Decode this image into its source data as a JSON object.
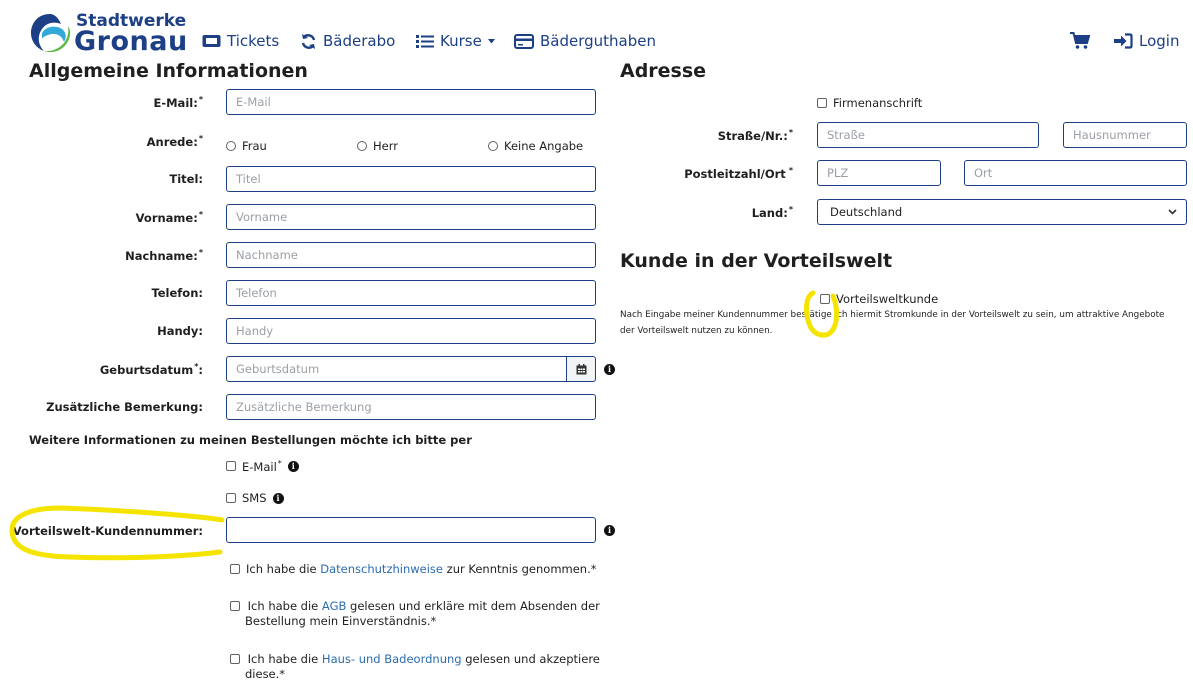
{
  "brand": {
    "line1": "Stadtwerke",
    "line2": "Gronau"
  },
  "nav": {
    "tickets": "Tickets",
    "baederabo": "Bäderabo",
    "kurse": "Kurse",
    "baederguthaben": "Bäderguthaben",
    "login": "Login"
  },
  "general": {
    "title": "Allgemeine Informationen",
    "email": {
      "label": "E-Mail:",
      "placeholder": "E-Mail"
    },
    "anrede": {
      "label": "Anrede:",
      "options": [
        "Frau",
        "Herr",
        "Keine Angabe"
      ]
    },
    "titel": {
      "label": "Titel:",
      "placeholder": "Titel"
    },
    "vorname": {
      "label": "Vorname:",
      "placeholder": "Vorname"
    },
    "nachname": {
      "label": "Nachname:",
      "placeholder": "Nachname"
    },
    "telefon": {
      "label": "Telefon:",
      "placeholder": "Telefon"
    },
    "handy": {
      "label": "Handy:",
      "placeholder": "Handy"
    },
    "geburtsdatum": {
      "label": "Geburtsdatum",
      "label_suffix": ":",
      "placeholder": "Geburtsdatum"
    },
    "bemerkung": {
      "label": "Zusätzliche Bemerkung:",
      "placeholder": "Zusätzliche Bemerkung"
    },
    "contact_pref": "Weitere Informationen zu meinen Bestellungen möchte ich bitte per",
    "contact_email": "E-Mail",
    "contact_sms": "SMS",
    "kundennummer": {
      "label": "Vorteilswelt-Kundennummer:",
      "value": ""
    },
    "consent1": {
      "before": "Ich habe die ",
      "link": "Datenschutzhinweise",
      "after": " zur Kenntnis genommen.*"
    },
    "consent2": {
      "before": "Ich habe die ",
      "link": "AGB",
      "after1": " gelesen und erkläre mit dem Absenden der",
      "line2": "Bestellung mein Einverständnis.*"
    },
    "consent3": {
      "before": "Ich habe die ",
      "link": "Haus- und Badeordnung",
      "after1": " gelesen und akzeptiere",
      "line2": "diese.*"
    }
  },
  "address": {
    "title": "Adresse",
    "firma": "Firmenanschrift",
    "strasse": {
      "label": "Straße/Nr.:",
      "placeholder": "Straße",
      "placeholder_nr": "Hausnummer"
    },
    "plz": {
      "label": "Postleitzahl/Ort",
      "placeholder": "PLZ",
      "placeholder_ort": "Ort"
    },
    "land": {
      "label": "Land:",
      "value": "Deutschland"
    }
  },
  "vorteil": {
    "title": "Kunde in der Vorteilswelt",
    "checkbox": "Vorteilsweltkunde",
    "text1": "Nach Eingabe meiner Kundennummer bestätige ich hiermit Stromkunde in der Vorteilswelt zu sein, um attraktive Angebote",
    "text2": "der Vorteilswelt nutzen zu können."
  },
  "icons": [
    "logo",
    "ticket-icon",
    "sync-icon",
    "list-icon",
    "credit-card-icon",
    "chevron-down-icon",
    "cart-icon",
    "login-icon",
    "calendar-icon",
    "info-icon"
  ],
  "colors": {
    "brand": "#1c3f85",
    "input_border": "#1c3f85",
    "highlight": "#f5e400",
    "link": "#2b6cb0"
  }
}
